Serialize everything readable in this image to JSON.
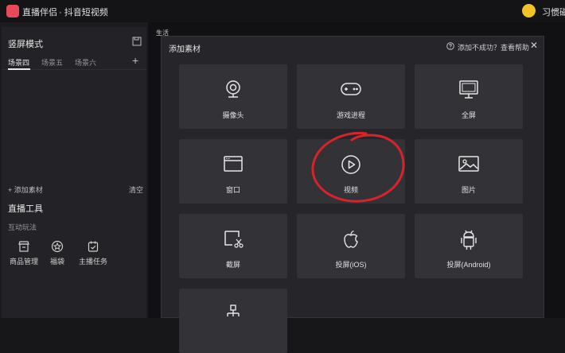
{
  "titlebar": {
    "app_name": "直播伴侣",
    "mode": "· 抖音短视频",
    "user_name": "习惯磁"
  },
  "scene_panel": {
    "title": "竖屏模式",
    "tabs": [
      "场景四",
      "场景五",
      "场景六"
    ],
    "add_material": "+ 添加素材",
    "clear": "清空"
  },
  "tools_panel": {
    "title": "直播工具",
    "section": "互动玩法",
    "items": [
      {
        "label": "商品管理",
        "icon": "shop-icon"
      },
      {
        "label": "福袋",
        "icon": "lucky-bag-icon"
      },
      {
        "label": "主播任务",
        "icon": "task-icon"
      }
    ]
  },
  "workspace": {
    "live_label": "生活"
  },
  "modal": {
    "title": "添加素材",
    "help_text": "添加不成功？查看帮助",
    "close": "✕",
    "tiles": [
      {
        "label": "摄像头",
        "icon": "camera-icon"
      },
      {
        "label": "游戏进程",
        "icon": "gamepad-icon"
      },
      {
        "label": "全屏",
        "icon": "monitor-icon"
      },
      {
        "label": "窗口",
        "icon": "window-icon"
      },
      {
        "label": "视频",
        "icon": "play-icon"
      },
      {
        "label": "图片",
        "icon": "image-icon"
      },
      {
        "label": "截屏",
        "icon": "screenshot-icon"
      },
      {
        "label": "投屏(iOS)",
        "icon": "apple-icon"
      },
      {
        "label": "投屏(Android)",
        "icon": "android-icon"
      },
      {
        "label": "",
        "icon": "network-icon"
      }
    ]
  },
  "colors": {
    "accent": "#e94a5a",
    "annotation": "#d8232a",
    "tile_bg": "#323237",
    "modal_bg": "#26262a"
  }
}
